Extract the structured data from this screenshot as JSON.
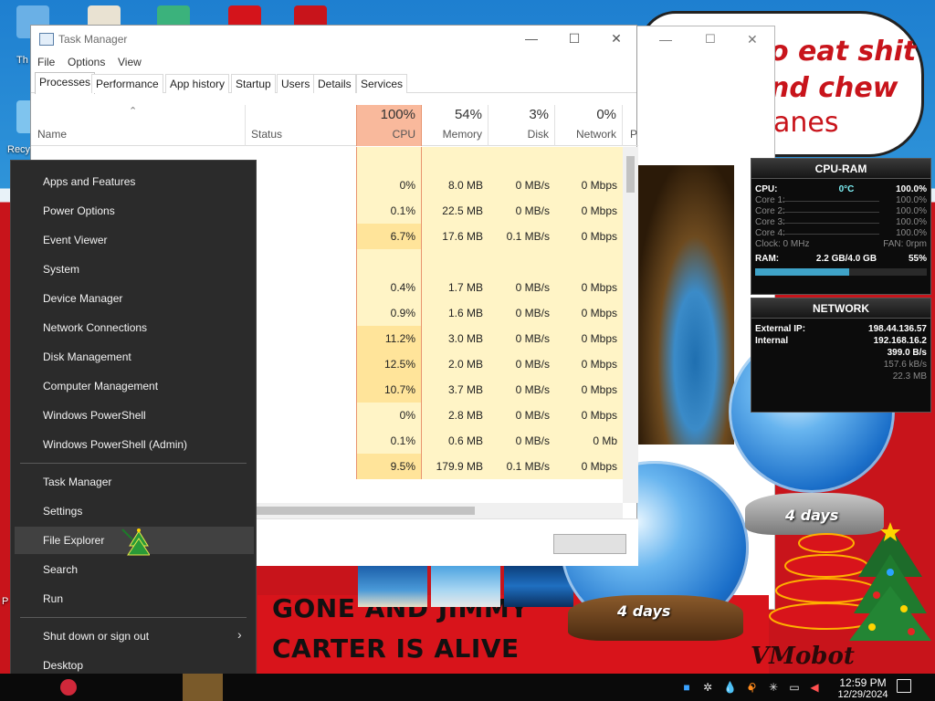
{
  "task_manager": {
    "title": "Task Manager",
    "window_buttons": {
      "minimize": "—",
      "maximize": "☐",
      "close": "✕"
    },
    "menu": [
      "File",
      "Options",
      "View"
    ],
    "tabs": [
      "Processes",
      "Performance",
      "App history",
      "Startup",
      "Users",
      "Details",
      "Services"
    ],
    "active_tab": "Processes",
    "columns": {
      "name": "Name",
      "status": "Status",
      "cpu": {
        "pct": "100%",
        "label": "CPU"
      },
      "memory": {
        "pct": "54%",
        "label": "Memory"
      },
      "disk": {
        "pct": "3%",
        "label": "Disk"
      },
      "network": {
        "pct": "0%",
        "label": "Network"
      },
      "power": "P"
    },
    "rows": [
      {
        "cpu": "",
        "memory": "",
        "disk": "",
        "network": ""
      },
      {
        "cpu": "0%",
        "memory": "8.0 MB",
        "disk": "0 MB/s",
        "network": "0 Mbps"
      },
      {
        "cpu": "0.1%",
        "memory": "22.5 MB",
        "disk": "0 MB/s",
        "network": "0 Mbps"
      },
      {
        "cpu": "6.7%",
        "memory": "17.6 MB",
        "disk": "0.1 MB/s",
        "network": "0 Mbps"
      },
      {
        "cpu": "",
        "memory": "",
        "disk": "",
        "network": ""
      },
      {
        "cpu": "0.4%",
        "memory": "1.7 MB",
        "disk": "0 MB/s",
        "network": "0 Mbps"
      },
      {
        "cpu": "0.9%",
        "memory": "1.6 MB",
        "disk": "0 MB/s",
        "network": "0 Mbps"
      },
      {
        "cpu": "11.2%",
        "memory": "3.0 MB",
        "disk": "0 MB/s",
        "network": "0 Mbps"
      },
      {
        "cpu": "12.5%",
        "memory": "2.0 MB",
        "disk": "0 MB/s",
        "network": "0 Mbps"
      },
      {
        "cpu": "10.7%",
        "memory": "3.7 MB",
        "disk": "0 MB/s",
        "network": "0 Mbps"
      },
      {
        "cpu": "0%",
        "memory": "2.8 MB",
        "disk": "0 MB/s",
        "network": "0 Mbps"
      },
      {
        "cpu": "0.1%",
        "memory": "0.6 MB",
        "disk": "0 MB/s",
        "network": "0 Mb"
      },
      {
        "cpu": "9.5%",
        "memory": "179.9 MB",
        "disk": "0.1 MB/s",
        "network": "0 Mbps"
      }
    ]
  },
  "winx_menu": {
    "group1": [
      "Apps and Features",
      "Power Options",
      "Event Viewer",
      "System",
      "Device Manager",
      "Network Connections",
      "Disk Management",
      "Computer Management",
      "Windows PowerShell",
      "Windows PowerShell (Admin)"
    ],
    "group2": [
      "Task Manager",
      "Settings",
      "File Explorer",
      "Search",
      "Run"
    ],
    "group3": [
      "Shut down or sign out",
      "Desktop"
    ],
    "hovered": "File Explorer"
  },
  "cpu_ram_gadget": {
    "title": "CPU-RAM",
    "cpu_label": "CPU:",
    "cpu_temp": "0°C",
    "cpu_pct": "100.0%",
    "cores": [
      {
        "label": "Core 1:",
        "value": "100.0%"
      },
      {
        "label": "Core 2:",
        "value": "100.0%"
      },
      {
        "label": "Core 3:",
        "value": "100.0%"
      },
      {
        "label": "Core 4:",
        "value": "100.0%"
      }
    ],
    "clock": "Clock: 0 MHz",
    "fan": "FAN: 0rpm",
    "ram_label": "RAM:",
    "ram_value": "2.2 GB/4.0 GB",
    "ram_pct": "55%"
  },
  "network_gadget": {
    "title": "NETWORK",
    "external_ip_label": "External IP:",
    "external_ip": "198.44.136.57",
    "internal_ip_label": "Internal",
    "internal_ip": "192.168.16.2",
    "rows": [
      "399.0 B/s",
      "157.6 kB/s",
      "22.3 MB"
    ]
  },
  "desktop": {
    "bubble_lines": [
      "o eat shit",
      "nd chew",
      "anes"
    ],
    "banner_lines": [
      "GONE AND JIMMY",
      "CARTER IS ALIVE"
    ],
    "watermark": "VMobot",
    "icon_labels": [
      "Th",
      "Recy",
      "P"
    ],
    "globe_labels": [
      "4 days",
      "4 days"
    ]
  },
  "taskbar": {
    "time": "12:59 PM",
    "date": "12/29/2024"
  },
  "colors": {
    "cpu_header": "#f9b99c",
    "heat_low": "#fff4c6",
    "heat_mid": "#ffe49a",
    "winx_bg": "#2b2b2b",
    "banner_red": "#d8141b"
  }
}
